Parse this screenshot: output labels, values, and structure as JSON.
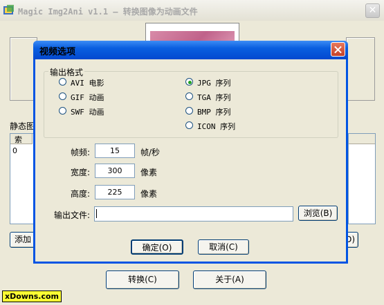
{
  "main": {
    "title": "Magic Img2Ani v1.1 — 转换图像为动画文件",
    "static_label": "静态图",
    "list_header": "索",
    "list_cell": "0",
    "add_button": "添加图",
    "right_button": "D)",
    "convert_button": "转换(C)",
    "about_button": "关于(A)",
    "watermark": "xDowns.com"
  },
  "dialog": {
    "title": "视频选项",
    "output_format_label": "输出格式",
    "formats_left": [
      "AVI 电影",
      "GIF 动画",
      "SWF 动画"
    ],
    "formats_right": [
      "JPG 序列",
      "TGA 序列",
      "BMP 序列",
      "ICON 序列"
    ],
    "selected_format": "JPG 序列",
    "fields": [
      {
        "label": "帧频:",
        "value": "15",
        "unit": "帧/秒"
      },
      {
        "label": "宽度:",
        "value": "300",
        "unit": "像素"
      },
      {
        "label": "高度:",
        "value": "225",
        "unit": "像素"
      }
    ],
    "output_file_label": "输出文件:",
    "output_file_value": "",
    "browse_button": "浏览(B)",
    "ok_button": "确定(O)",
    "cancel_button": "取消(C)"
  },
  "colors": {
    "dialog_border": "#0054e3",
    "close_button": "#c4412a",
    "watermark_bg": "#ffff33"
  }
}
